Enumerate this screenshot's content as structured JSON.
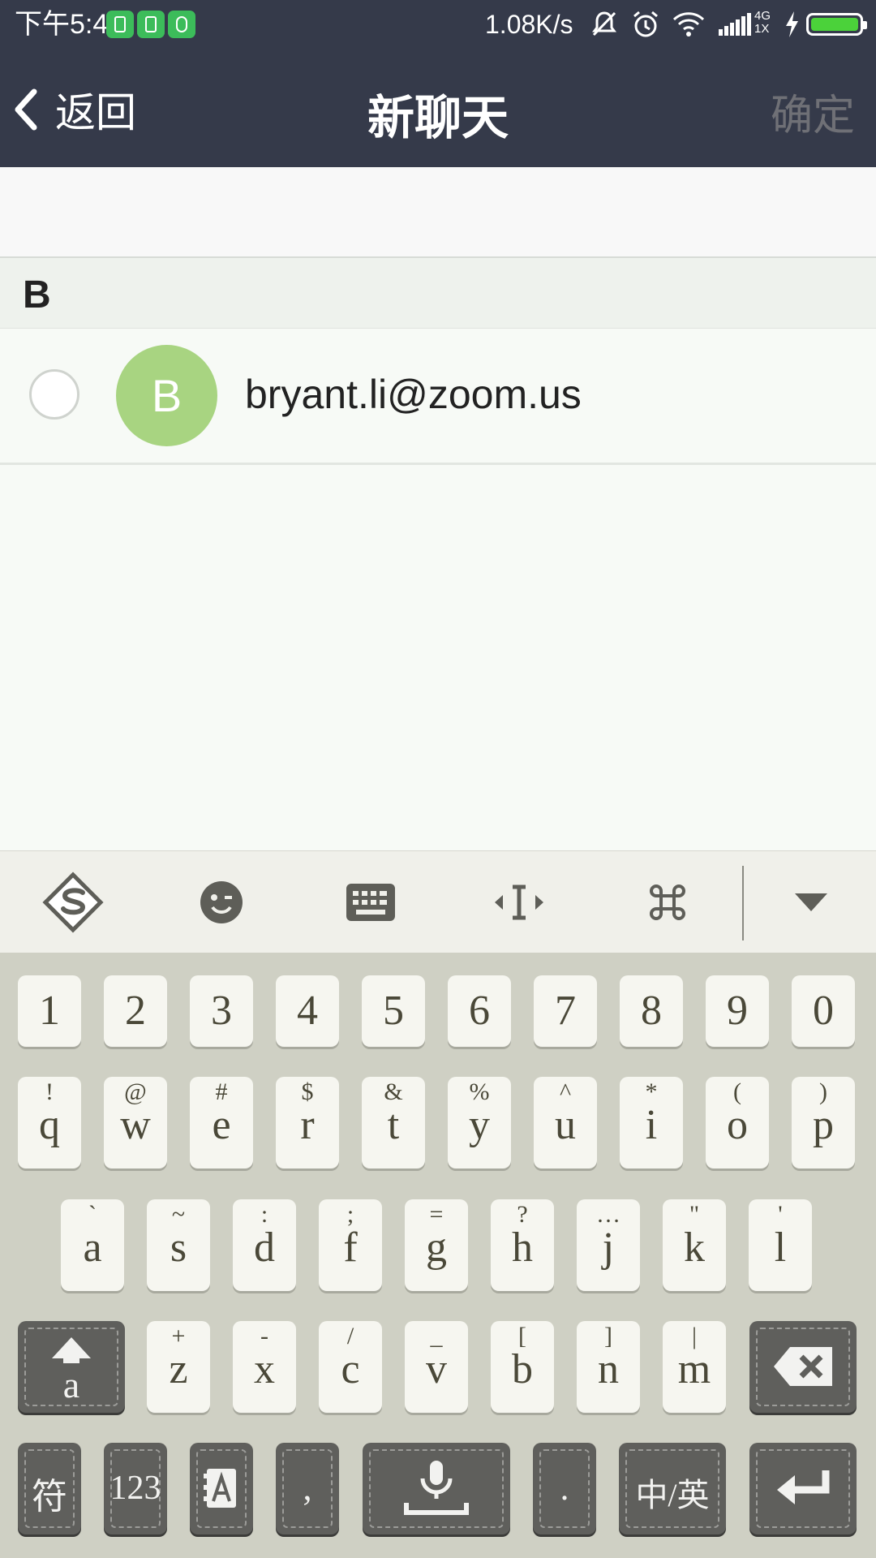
{
  "status_bar": {
    "time": "下午5:42",
    "net_speed": "1.08K/s",
    "network_type_top": "4G",
    "network_type_bottom": "1X"
  },
  "nav": {
    "back_label": "返回",
    "title": "新聊天",
    "confirm_label": "确定"
  },
  "contacts": {
    "section_letter": "B",
    "items": [
      {
        "avatar_letter": "B",
        "name": "bryant.li@zoom.us"
      }
    ]
  },
  "keyboard": {
    "toolbar_icons": [
      "sogou-logo-icon",
      "emoji-icon",
      "keyboard-icon",
      "cursor-icon",
      "command-icon",
      "collapse-icon"
    ],
    "number_row": [
      "1",
      "2",
      "3",
      "4",
      "5",
      "6",
      "7",
      "8",
      "9",
      "0"
    ],
    "row1": [
      {
        "main": "q",
        "sup": "!"
      },
      {
        "main": "w",
        "sup": "@"
      },
      {
        "main": "e",
        "sup": "#"
      },
      {
        "main": "r",
        "sup": "$"
      },
      {
        "main": "t",
        "sup": "&"
      },
      {
        "main": "y",
        "sup": "%"
      },
      {
        "main": "u",
        "sup": "^"
      },
      {
        "main": "i",
        "sup": "*"
      },
      {
        "main": "o",
        "sup": "("
      },
      {
        "main": "p",
        "sup": ")"
      }
    ],
    "row2": [
      {
        "main": "a",
        "sup": "`"
      },
      {
        "main": "s",
        "sup": "~"
      },
      {
        "main": "d",
        "sup": ":"
      },
      {
        "main": "f",
        "sup": ";"
      },
      {
        "main": "g",
        "sup": "="
      },
      {
        "main": "h",
        "sup": "?"
      },
      {
        "main": "j",
        "sup": "…"
      },
      {
        "main": "k",
        "sup": "\""
      },
      {
        "main": "l",
        "sup": "'"
      }
    ],
    "row3": [
      {
        "main": "z",
        "sup": "+"
      },
      {
        "main": "x",
        "sup": "-"
      },
      {
        "main": "c",
        "sup": "/"
      },
      {
        "main": "v",
        "sup": "_"
      },
      {
        "main": "b",
        "sup": "["
      },
      {
        "main": "n",
        "sup": "]"
      },
      {
        "main": "m",
        "sup": "|"
      }
    ],
    "shift_label": "a",
    "symbol_label": "符",
    "numeric_label": "123",
    "comma_label": ",",
    "period_label": ".",
    "lang_label": "中/英"
  }
}
